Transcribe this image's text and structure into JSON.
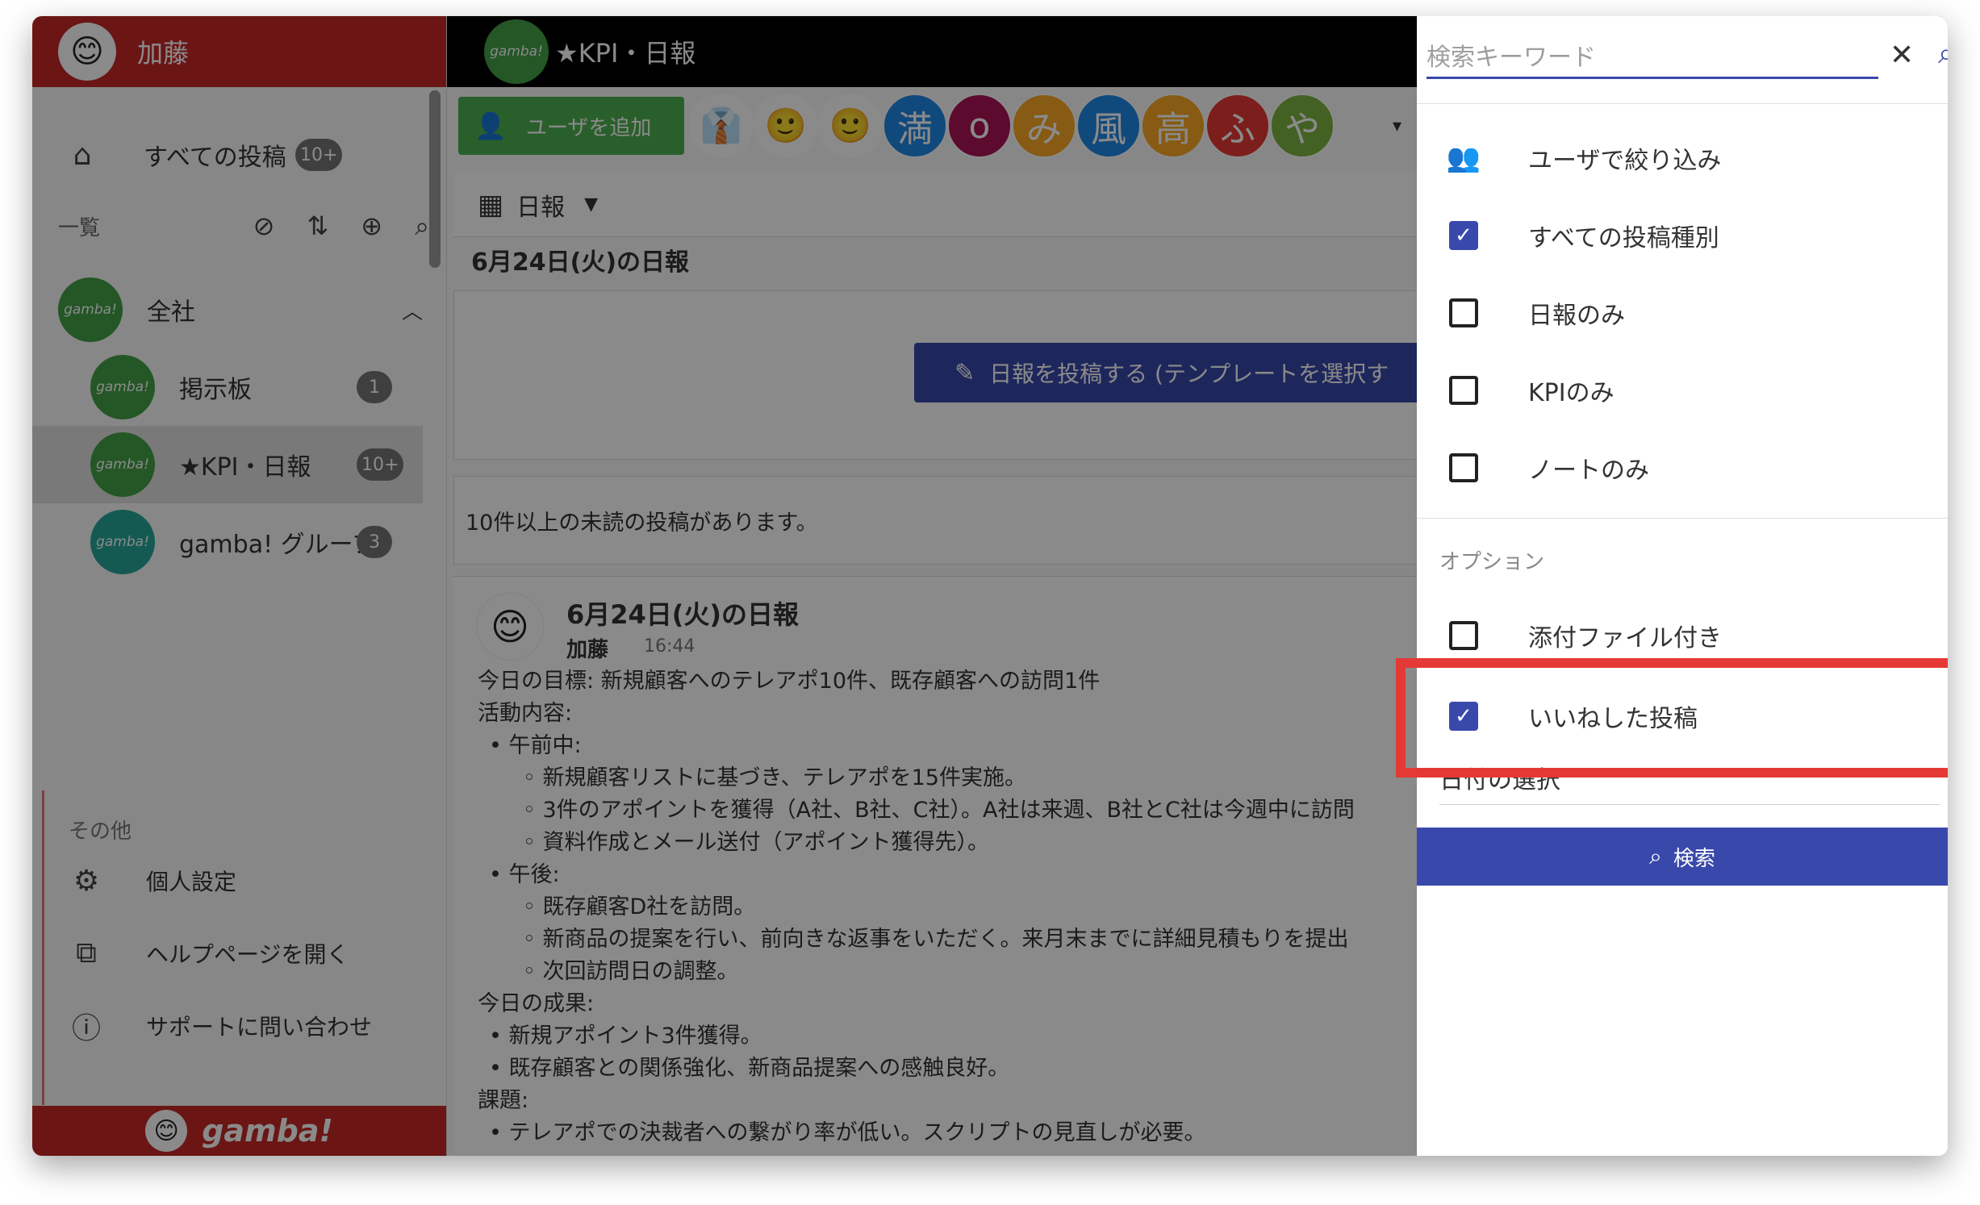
{
  "sidebar": {
    "user_name": "加藤",
    "user_avatar": "avatar-face",
    "all_posts": {
      "label": "すべての投稿",
      "badge": "10+",
      "icon": "home-icon"
    },
    "list_title": "一覧",
    "list_tools": [
      "filter-off-icon",
      "sort-icon",
      "add-circle-icon",
      "search-icon"
    ],
    "groups": [
      {
        "label": "全社",
        "avatar_text": "gamba!",
        "badge": ""
      },
      {
        "label": "掲示板",
        "avatar_text": "gamba!",
        "badge": "1"
      },
      {
        "label": "★KPI・日報",
        "avatar_text": "gamba!",
        "badge": "10+"
      },
      {
        "label": "gamba! グループ",
        "avatar_text": "gamba!",
        "badge": "3"
      }
    ],
    "other_title": "その他",
    "other_items": [
      {
        "label": "個人設定",
        "icon": "gear-icon"
      },
      {
        "label": "ヘルプページを開く",
        "icon": "open-external-icon"
      },
      {
        "label": "サポートに問い合わせ",
        "icon": "help-icon"
      }
    ],
    "footer_text": "gamba!"
  },
  "main": {
    "channel_title": "★KPI・日報",
    "channel_avatar_text": "gamba!",
    "add_user_label": "ユーザを追加",
    "members": [
      {
        "text": "👔",
        "color": "#ffffff"
      },
      {
        "text": "🙂",
        "color": "#ffffff"
      },
      {
        "text": "🙂",
        "color": "#ffffff"
      },
      {
        "text": "満",
        "color": "#1e88e5"
      },
      {
        "text": "o",
        "color": "#ad1457"
      },
      {
        "text": "み",
        "color": "#f9a825"
      },
      {
        "text": "風",
        "color": "#1e88e5"
      },
      {
        "text": "高",
        "color": "#f9a825"
      },
      {
        "text": "ふ",
        "color": "#e53935"
      },
      {
        "text": "や",
        "color": "#7cb342"
      }
    ],
    "type_select": "日報",
    "date_heading": "6月24日(火)の日報",
    "post_button_label": "日報を投稿する (テンプレートを選択す",
    "unread_notice": "10件以上の未読の投稿があります。",
    "article": {
      "title": "6月24日(火)の日報",
      "author": "加藤",
      "time": "16:44",
      "lines": [
        {
          "text": "今日の目標: 新規顧客へのテレアポ10件、既存顧客への訪問1件",
          "level": 0
        },
        {
          "text": "活動内容:",
          "level": 0
        },
        {
          "text": "• 午前中:",
          "level": 1
        },
        {
          "text": "◦ 新規顧客リストに基づき、テレアポを15件実施。",
          "level": 2
        },
        {
          "text": "◦ 3件のアポイントを獲得（A社、B社、C社）。A社は来週、B社とC社は今週中に訪問",
          "level": 2
        },
        {
          "text": "◦ 資料作成とメール送付（アポイント獲得先）。",
          "level": 2
        },
        {
          "text": "• 午後:",
          "level": 1
        },
        {
          "text": "◦ 既存顧客D社を訪問。",
          "level": 2
        },
        {
          "text": "◦ 新商品の提案を行い、前向きな返事をいただく。来月末までに詳細見積もりを提出",
          "level": 2
        },
        {
          "text": "◦ 次回訪問日の調整。",
          "level": 2
        },
        {
          "text": "今日の成果:",
          "level": 0
        },
        {
          "text": "• 新規アポイント3件獲得。",
          "level": 1
        },
        {
          "text": "• 既存顧客との関係強化、新商品提案への感触良好。",
          "level": 1
        },
        {
          "text": "課題:",
          "level": 0
        },
        {
          "text": "• テレアポでの決裁者への繋がり率が低い。スクリプトの見直しが必要。",
          "level": 1
        }
      ]
    }
  },
  "search": {
    "placeholder": "検索キーワード",
    "user_filter_label": "ユーザで絞り込み",
    "types": [
      {
        "label": "すべての投稿種別",
        "checked": true
      },
      {
        "label": "日報のみ",
        "checked": false
      },
      {
        "label": "KPIのみ",
        "checked": false
      },
      {
        "label": "ノートのみ",
        "checked": false
      }
    ],
    "options_title": "オプション",
    "options": [
      {
        "label": "添付ファイル付き",
        "checked": false
      },
      {
        "label": "いいねした投稿",
        "checked": true
      }
    ],
    "date_label": "日付の選択",
    "search_button_label": "検索"
  },
  "colors": {
    "brand_red": "#c62828",
    "accent_indigo": "#3949ab",
    "add_user_green": "#4caf50",
    "highlight_red": "#e53935"
  }
}
